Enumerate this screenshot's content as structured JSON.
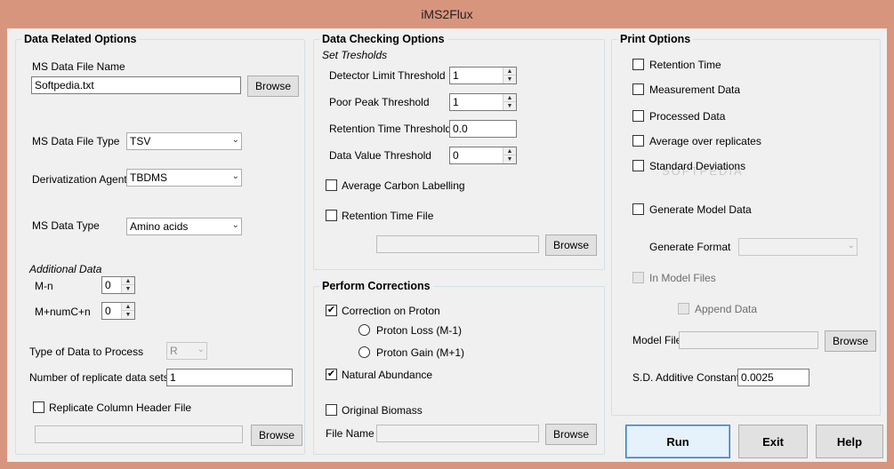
{
  "window": {
    "title": "iMS2Flux"
  },
  "data_related": {
    "legend": "Data Related Options",
    "ms_file_label": "MS Data File Name",
    "ms_file_value": "Softpedia.txt",
    "browse": "Browse",
    "file_type_label": "MS Data File Type",
    "file_type_value": "TSV",
    "deriv_label": "Derivatization Agent",
    "deriv_value": "TBDMS",
    "data_type_label": "MS Data Type",
    "data_type_value": "Amino acids",
    "additional_label": "Additional Data",
    "mn_label": "M-n",
    "mn_value": "0",
    "mnumc_label": "M+numC+n",
    "mnumc_value": "0",
    "type_process_label": "Type of Data to Process",
    "type_process_value": "R",
    "replicates_label": "Number of replicate data sets",
    "replicates_value": "1",
    "replicate_header_label": "Replicate Column Header File",
    "replicate_header_checked": false,
    "replicate_file_value": "",
    "browse2": "Browse"
  },
  "data_checking": {
    "legend": "Data Checking Options",
    "set_thresholds": "Set Tresholds",
    "detector_label": "Detector Limit Threshold",
    "detector_value": "1",
    "poor_peak_label": "Poor Peak Threshold",
    "poor_peak_value": "1",
    "retention_thr_label": "Retention Time Threshold",
    "retention_thr_value": "0.0",
    "data_value_label": "Data Value Threshold",
    "data_value_value": "0",
    "avg_carbon_label": "Average Carbon Labelling",
    "avg_carbon_checked": false,
    "retention_file_label": "Retention Time File",
    "retention_file_checked": false,
    "retention_file_value": "",
    "browse": "Browse"
  },
  "corrections": {
    "legend": "Perform Corrections",
    "proton_label": "Correction on Proton",
    "proton_checked": true,
    "proton_loss_label": "Proton Loss (M-1)",
    "proton_gain_label": "Proton Gain (M+1)",
    "natural_label": "Natural Abundance",
    "natural_checked": true,
    "biomass_label": "Original Biomass",
    "biomass_checked": false,
    "file_name_label": "File Name",
    "file_name_value": "",
    "browse": "Browse"
  },
  "print_options": {
    "legend": "Print Options",
    "retention_time_label": "Retention Time",
    "measurement_label": "Measurement Data",
    "processed_label": "Processed Data",
    "average_label": "Average over replicates",
    "std_label": "Standard Deviations",
    "generate_model_label": "Generate Model Data",
    "generate_format_label": "Generate Format",
    "generate_format_value": "",
    "in_model_label": "In Model Files",
    "append_label": "Append Data",
    "model_file_label": "Model File",
    "model_file_value": "",
    "browse": "Browse",
    "sd_const_label": "S.D. Additive Constant",
    "sd_const_value": "0.0025",
    "watermark": "SOFTPEDIA"
  },
  "actions": {
    "run": "Run",
    "exit": "Exit",
    "help": "Help"
  },
  "colors": {
    "frame": "#d8957d",
    "client": "#f0f0f0",
    "run_accent": "#3c7fb1"
  }
}
